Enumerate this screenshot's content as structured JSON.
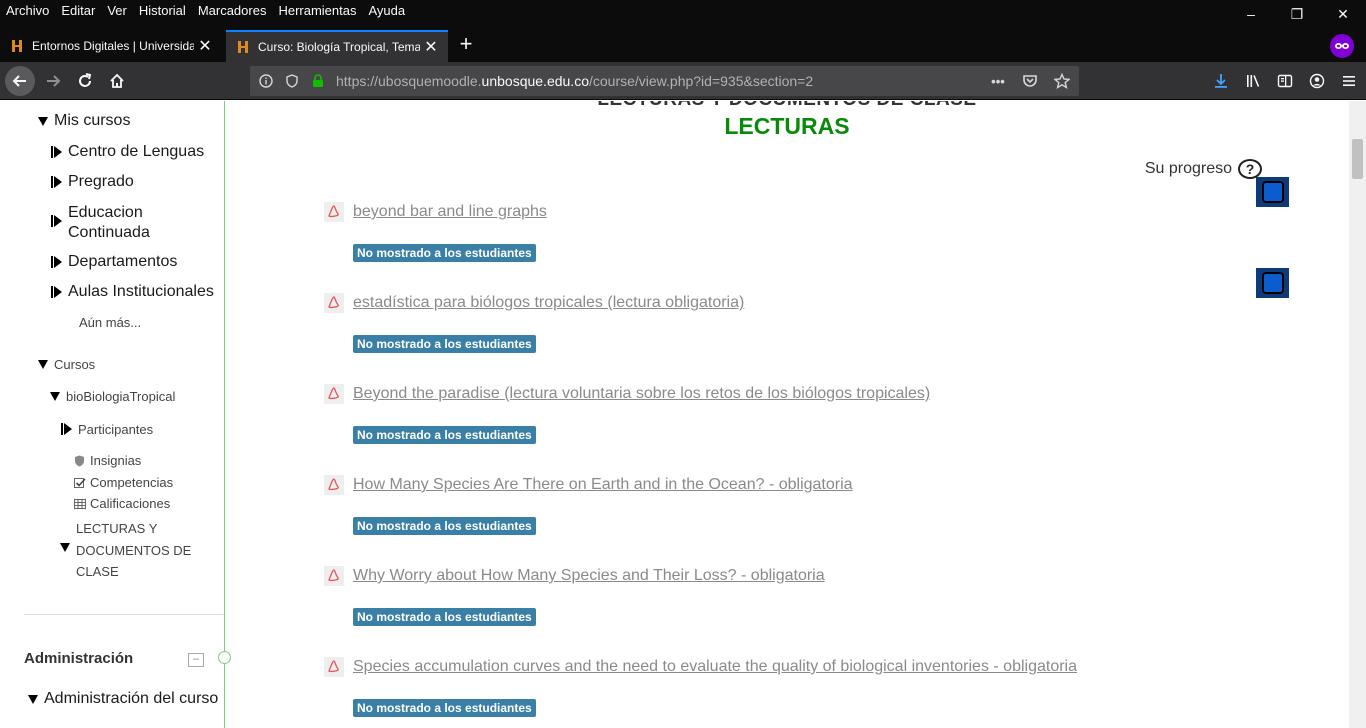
{
  "menubar": {
    "items": [
      "Archivo",
      "Editar",
      "Ver",
      "Historial",
      "Marcadores",
      "Herramientas",
      "Ayuda"
    ],
    "minimize": "–",
    "restore": "❐",
    "close": "✕"
  },
  "tabs": [
    {
      "title": "Entornos Digitales | Universidad",
      "close": "✕"
    },
    {
      "title": "Curso: Biología Tropical, Temas",
      "close": "✕"
    }
  ],
  "new_tab": "+",
  "urlbar": {
    "prefix": "https://ubosquemoodle.",
    "host": "unbosque.edu.co",
    "suffix": "/course/view.php?id=935&section=2",
    "more": "•••"
  },
  "sidebar": {
    "mis_cursos": "Mis cursos",
    "centro_lenguas": "Centro de Lenguas",
    "pregrado": "Pregrado",
    "educacion_1": "Educacion",
    "educacion_2": "Continuada",
    "departamentos": "Departamentos",
    "aulas": "Aulas Institucionales",
    "aun_mas": "Aún más...",
    "cursos": "Cursos",
    "curso": "bioBiologiaTropical",
    "participantes": "Participantes",
    "insignias": "Insignias",
    "competencias": "Competencias",
    "calificaciones": "Calificaciones",
    "lecturas_1": "LECTURAS Y",
    "lecturas_2": "DOCUMENTOS DE",
    "lecturas_3": "CLASE",
    "administracion": "Administración",
    "collapse": "–",
    "admin_curso": "Administración del curso"
  },
  "main": {
    "section_cut": "LECTURAS Y DOCUMENTOS DE CLASE",
    "section_title": "LECTURAS",
    "progress_label": "Su progreso",
    "help": "?",
    "badge_text": "No mostrado a los estudiantes",
    "activities": [
      {
        "title": "beyond bar and line graphs"
      },
      {
        "title": "estadística para biólogos tropicales (lectura obligatoria)"
      },
      {
        "title": "Beyond the paradise (lectura voluntaria sobre los retos de los biólogos tropicales)"
      },
      {
        "title": "How Many Species Are There on Earth and in the Ocean? - obligatoria"
      },
      {
        "title": "Why Worry about How Many Species and Their Loss? - obligatoria"
      },
      {
        "title": "Species accumulation curves and the need to evaluate the quality of biological inventories - obligatoria"
      }
    ]
  },
  "colors": {
    "accent": "#0a84ff",
    "section_title": "#0a8a0a",
    "badge": "#3a7fa6",
    "private": "#8000d7"
  }
}
